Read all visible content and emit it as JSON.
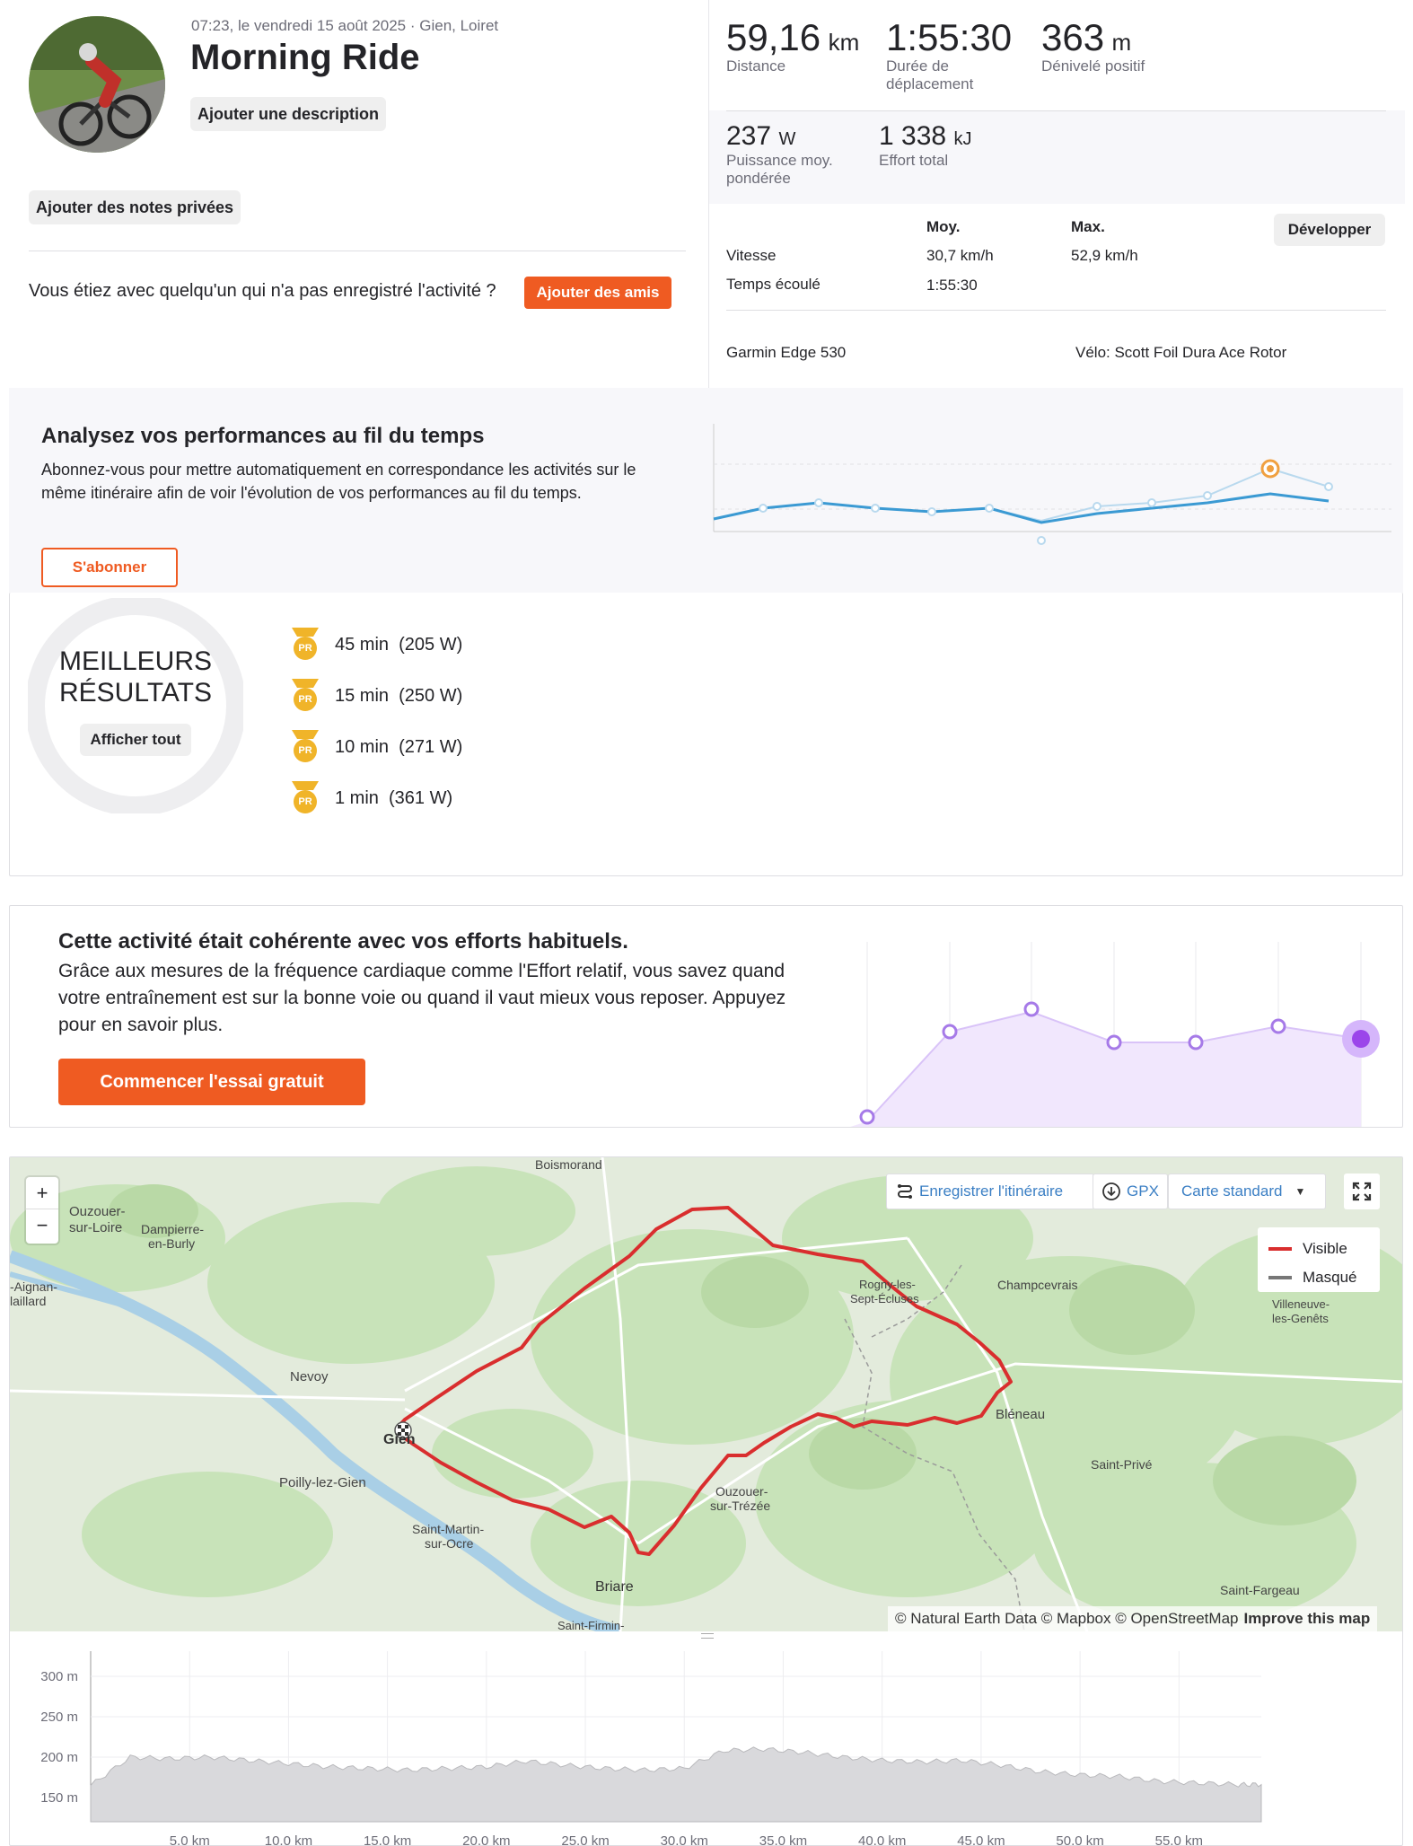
{
  "header": {
    "datetime": "07:23, le vendredi 15 août 2025 · Gien, Loiret",
    "title": "Morning Ride",
    "add_description": "Ajouter une description",
    "private_notes": "Ajouter des notes privées",
    "with_someone": "Vous étiez avec quelqu'un qui n'a pas enregistré l'activité ?",
    "add_friends": "Ajouter des amis"
  },
  "stats": {
    "distance": {
      "value": "59,16",
      "unit": "km",
      "label": "Distance"
    },
    "moving_time": {
      "value": "1:55:30",
      "label1": "Durée de",
      "label2": "déplacement"
    },
    "elevation": {
      "value": "363",
      "unit": "m",
      "label": "Dénivelé positif"
    },
    "power": {
      "value": "237",
      "unit": "W",
      "label1": "Puissance moy.",
      "label2": "pondérée"
    },
    "effort": {
      "value": "1 338",
      "unit": "kJ",
      "label": "Effort total"
    },
    "table": {
      "col_avg": "Moy.",
      "col_max": "Max.",
      "expand": "Développer",
      "rows": [
        {
          "label": "Vitesse",
          "avg": "30,7 km/h",
          "max": "52,9 km/h"
        },
        {
          "label": "Temps écoulé",
          "avg": "1:55:30",
          "max": ""
        }
      ]
    },
    "device": "Garmin Edge 530",
    "bike": "Vélo: Scott Foil Dura Ace Rotor"
  },
  "performance": {
    "title": "Analysez vos performances au fil du temps",
    "body": "Abonnez-vous pour mettre automatiquement en correspondance les activités sur le même itinéraire afin de voir l'évolution de vos performances au fil du temps.",
    "subscribe": "S'abonner"
  },
  "best_results": {
    "title1": "MEILLEURS",
    "title2": "RÉSULTATS",
    "show_all": "Afficher tout",
    "badge": "PR",
    "items": [
      "45 min  (205 W)",
      "15 min  (250 W)",
      "10 min  (271 W)",
      "1 min  (361 W)"
    ]
  },
  "relative_effort": {
    "title": "Cette activité était cohérente avec vos efforts habituels.",
    "body": "Grâce aux mesures de la fréquence cardiaque comme l'Effort relatif, vous savez quand votre entraînement est sur la bonne voie ou quand il vaut mieux vous reposer. Appuyez pour en savoir plus.",
    "cta": "Commencer l'essai gratuit"
  },
  "map": {
    "save_route": "Enregistrer l'itinéraire",
    "gpx": "GPX",
    "map_type": "Carte standard",
    "zoom_in": "+",
    "zoom_out": "−",
    "legend_visible": "Visible",
    "legend_hidden": "Masqué",
    "attribution": "© Natural Earth Data © Mapbox © OpenStreetMap",
    "improve": "Improve this map",
    "places": {
      "boismorand": "Boismorand",
      "ouzouer_loire1": "Ouzouer-",
      "ouzouer_loire2": "sur-Loire",
      "dampierre1": "Dampierre-",
      "dampierre2": "en-Burly",
      "aignan1": "-Aignan-",
      "aignan2": "laillard",
      "nevoy": "Nevoy",
      "gien": "Gien",
      "poilly": "Poilly-lez-Gien",
      "stmartin1": "Saint-Martin-",
      "stmartin2": "sur-Ocre",
      "briare": "Briare",
      "stfirmin": "Saint-Firmin-",
      "ouzouer_trezee1": "Ouzouer-",
      "ouzouer_trezee2": "sur-Trézée",
      "rogny1": "Rogny-les-",
      "rogny2": "Sept-Écluses",
      "champcevrais": "Champcevrais",
      "villeneuve1": "Villeneuve-",
      "villeneuve2": "les-Genêts",
      "bleneau": "Bléneau",
      "stprive": "Saint-Privé",
      "stfargeau": "Saint-Fargeau"
    }
  },
  "elevation_chart": {
    "y_ticks": [
      "300 m",
      "250 m",
      "200 m",
      "150 m"
    ],
    "x_ticks": [
      "5,0 km",
      "10,0 km",
      "15,0 km",
      "20,0 km",
      "25,0 km",
      "30,0 km",
      "35,0 km",
      "40,0 km",
      "45,0 km",
      "50,0 km",
      "55,0 km"
    ]
  },
  "chart_data": {
    "type": "area",
    "x": [
      0,
      2,
      4,
      6,
      8,
      10,
      12,
      14,
      16,
      18,
      20,
      22,
      24,
      26,
      28,
      30,
      32,
      34,
      36,
      38,
      40,
      42,
      44,
      46,
      48,
      50,
      52,
      54,
      56,
      58,
      59.16
    ],
    "values": [
      165,
      200,
      198,
      200,
      196,
      192,
      188,
      186,
      184,
      186,
      188,
      195,
      190,
      186,
      184,
      186,
      208,
      210,
      206,
      200,
      196,
      194,
      196,
      190,
      182,
      178,
      176,
      170,
      168,
      166,
      166
    ],
    "ylim": [
      120,
      320
    ],
    "xlim": [
      0,
      59.16
    ],
    "grid": true,
    "xlabel": "",
    "ylabel": ""
  },
  "colors": {
    "accent": "#ef5b22",
    "route": "#d92e2e",
    "purple": "#9b6be8",
    "blue": "#3b9ad3",
    "gold": "#f0b429"
  }
}
